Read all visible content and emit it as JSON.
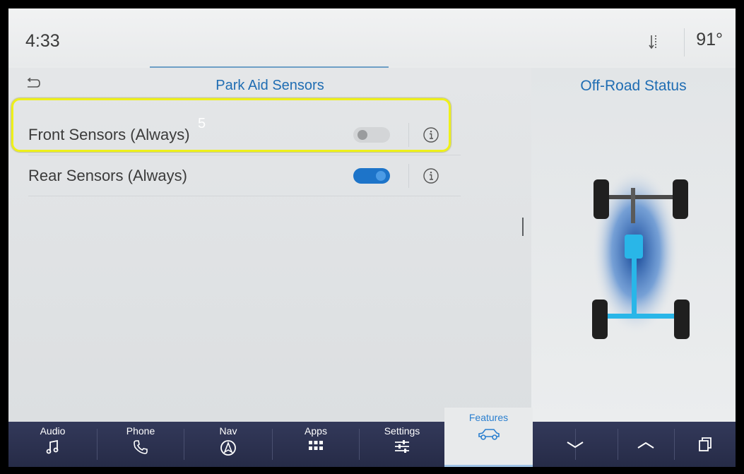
{
  "status_bar": {
    "time": "4:33",
    "temperature": "91°"
  },
  "park_aid": {
    "title": "Park Aid Sensors",
    "rows": [
      {
        "label": "Front Sensors (Always)",
        "toggle": "off"
      },
      {
        "label": "Rear Sensors (Always)",
        "toggle": "on"
      }
    ]
  },
  "annotation": "5",
  "off_road": {
    "title": "Off-Road Status"
  },
  "nav": {
    "items": [
      {
        "label": "Audio",
        "icon": "music-note-icon"
      },
      {
        "label": "Phone",
        "icon": "phone-icon"
      },
      {
        "label": "Nav",
        "icon": "navigation-icon"
      },
      {
        "label": "Apps",
        "icon": "apps-grid-icon"
      },
      {
        "label": "Settings",
        "icon": "sliders-icon"
      },
      {
        "label": "Features",
        "icon": "vehicle-icon"
      }
    ],
    "controls": [
      "chevron-down-icon",
      "chevron-up-icon",
      "windows-icon"
    ]
  },
  "colors": {
    "accent": "#1f6db3",
    "toggle_on": "#1d74c9",
    "highlight": "#eef01a",
    "drivetrain": "#29b6e8",
    "navbar": "#2e3452"
  }
}
